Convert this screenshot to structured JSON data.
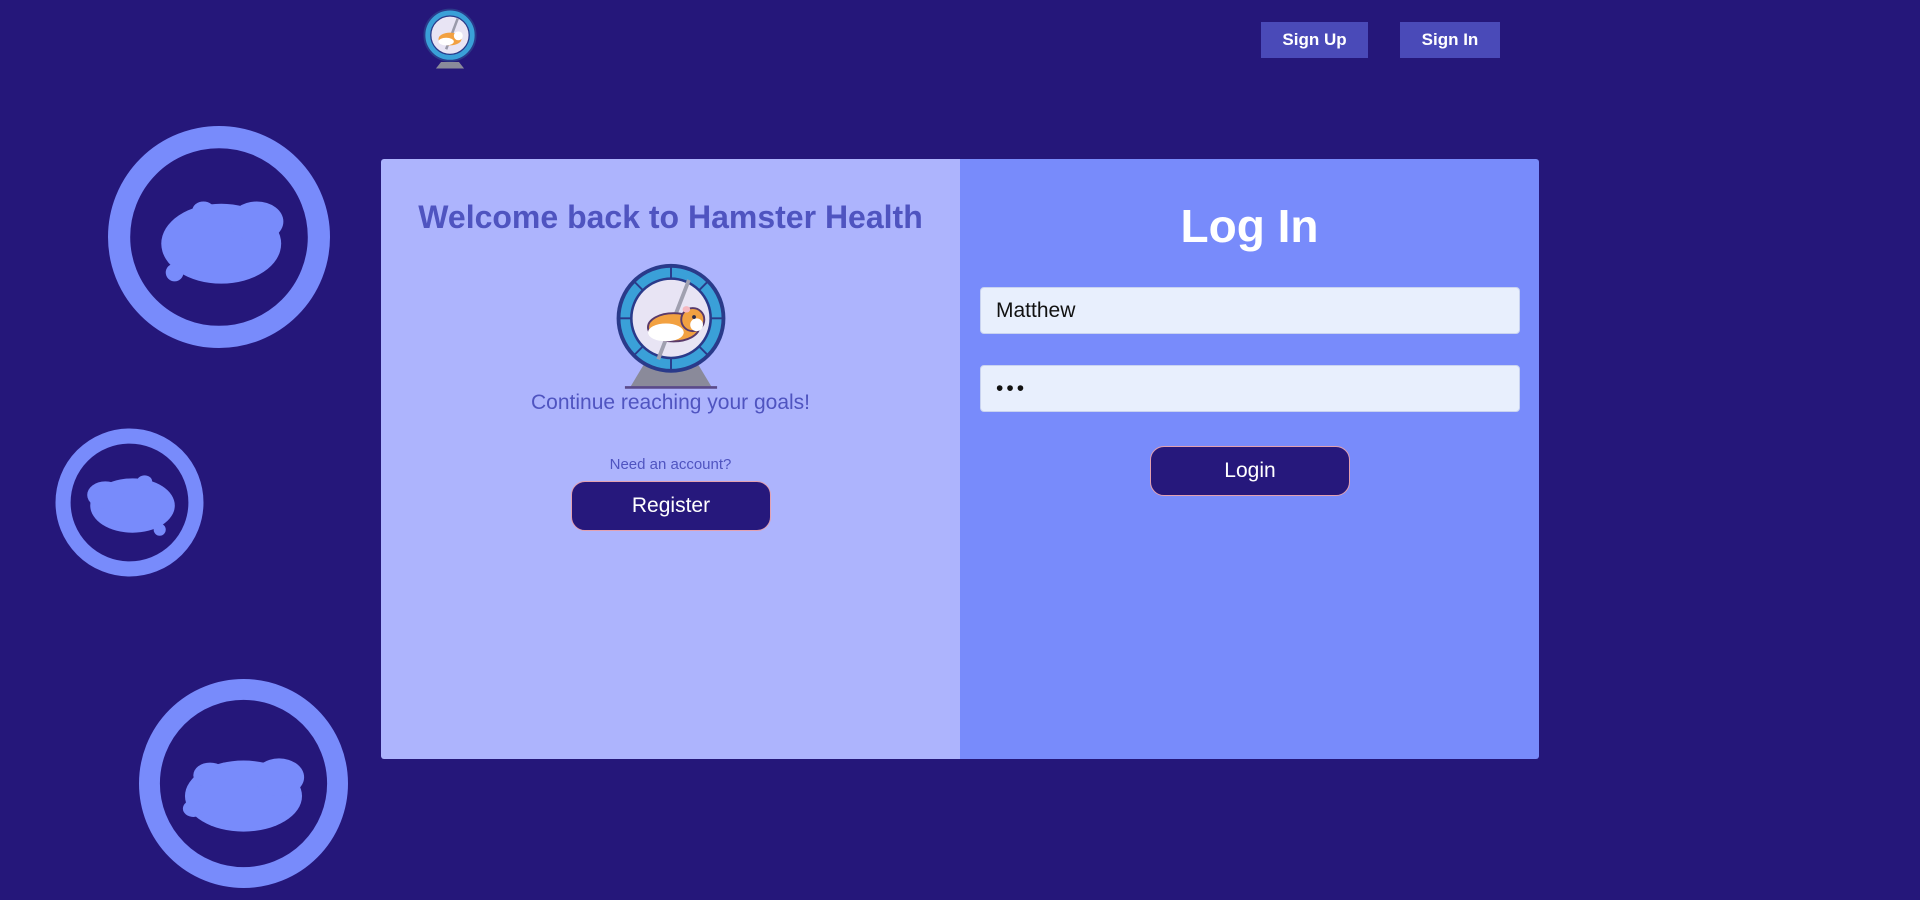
{
  "header": {
    "logo_icon": "hamster-wheel-logo",
    "signup_label": "Sign Up",
    "signin_label": "Sign In"
  },
  "welcome": {
    "title": "Welcome back to Hamster Health",
    "hero_icon": "hamster-wheel-icon",
    "tagline": "Continue reaching your goals!",
    "need_account": "Need an account?",
    "register_label": "Register"
  },
  "login": {
    "title": "Log In",
    "username_value": "Matthew",
    "password_value": "abc",
    "button_label": "Login"
  },
  "decor": {
    "background_icon": "hamster-wheel-silhouette"
  },
  "colors": {
    "page_bg": "#25177a",
    "left_panel": "#adb4fd",
    "right_panel": "#788bfb",
    "accent_text": "#4f54c0",
    "button_bg": "#26187c",
    "nav_button_bg": "#4a4ab8"
  }
}
